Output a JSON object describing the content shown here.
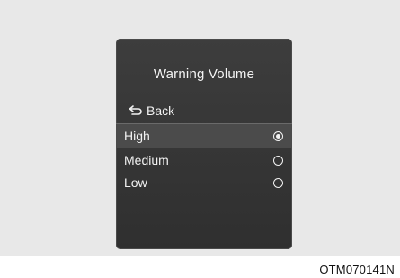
{
  "screen": {
    "title": "Warning Volume",
    "back_label": "Back",
    "options": [
      {
        "label": "High",
        "selected": true
      },
      {
        "label": "Medium",
        "selected": false
      },
      {
        "label": "Low",
        "selected": false
      }
    ]
  },
  "figure_code": "OTM070141N"
}
